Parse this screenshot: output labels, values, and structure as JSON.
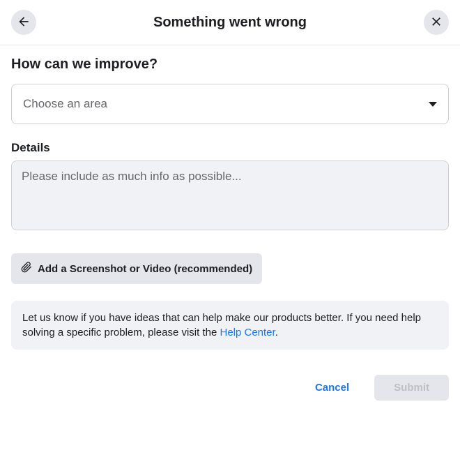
{
  "header": {
    "title": "Something went wrong"
  },
  "form": {
    "heading": "How can we improve?",
    "area_select": {
      "placeholder": "Choose an area"
    },
    "details": {
      "label": "Details",
      "placeholder": "Please include as much info as possible..."
    },
    "attach_label": "Add a Screenshot or Video (recommended)",
    "info": {
      "text_before": "Let us know if you have ideas that can help make our products better. If you need help solving a specific problem, please visit the ",
      "link_text": "Help Center",
      "text_after": "."
    }
  },
  "footer": {
    "cancel": "Cancel",
    "submit": "Submit"
  }
}
